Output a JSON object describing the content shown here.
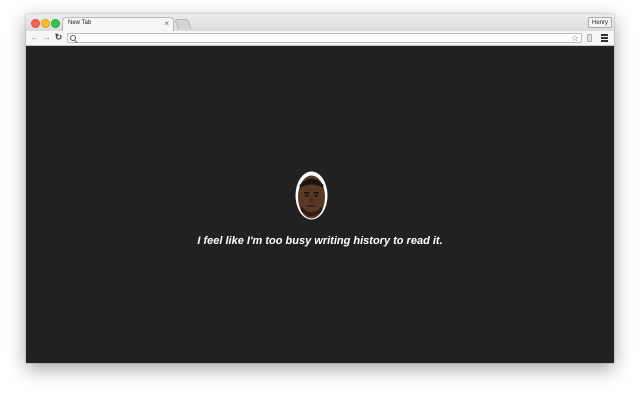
{
  "browser": {
    "tab": {
      "title": "New Tab",
      "close_glyph": "×"
    },
    "profile": {
      "name": "Henry"
    },
    "toolbar": {
      "back_glyph": "←",
      "forward_glyph": "→",
      "reload_glyph": "↻",
      "address_value": "",
      "star_glyph": "☆"
    }
  },
  "page": {
    "quote": "I feel like I'm too busy writing history to read it.",
    "background_color": "#212121"
  },
  "icons": [
    "close-icon",
    "minimize-icon",
    "maximize-icon",
    "back-icon",
    "forward-icon",
    "reload-icon",
    "search-icon",
    "bookmark-star-icon",
    "extension-icon",
    "menu-icon"
  ]
}
